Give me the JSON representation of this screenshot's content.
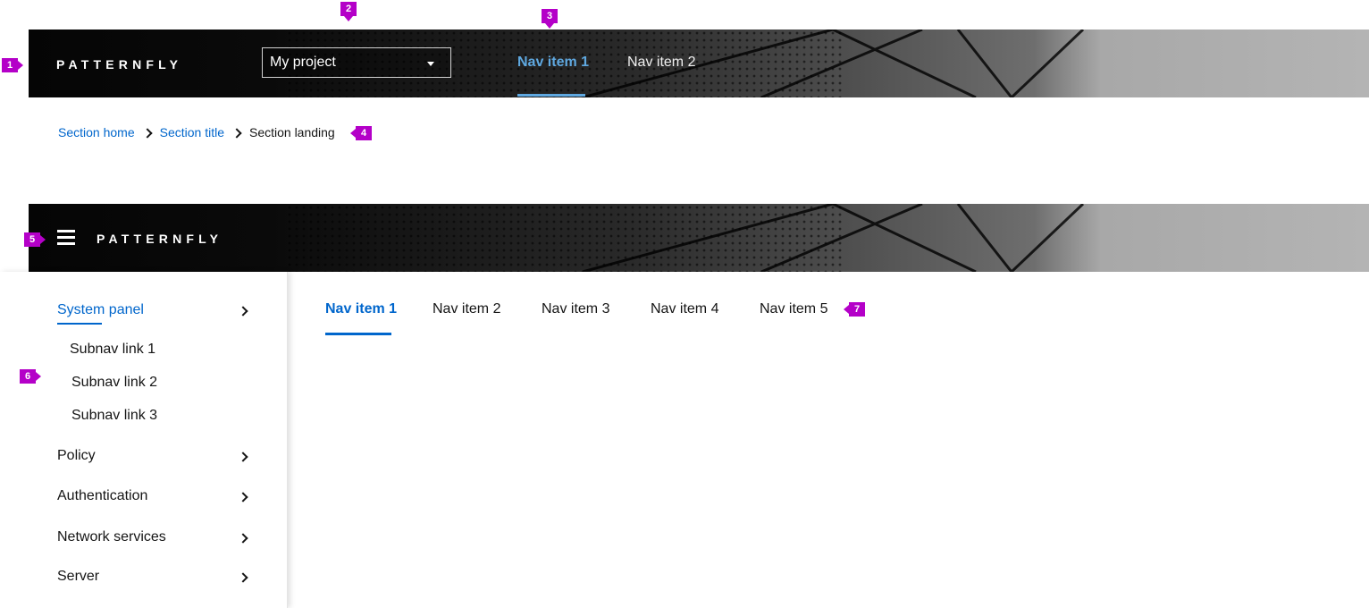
{
  "brand_name": "PATTERNFLY",
  "colors": {
    "accent": "#0066cc",
    "accent_light": "#5fa8e0",
    "marker": "#b400c8"
  },
  "top_masthead": {
    "project_select": {
      "value": "My project",
      "icon": "caret-down-icon"
    },
    "nav_items": [
      {
        "label": "Nav item 1",
        "active": true
      },
      {
        "label": "Nav item 2",
        "active": false
      }
    ]
  },
  "breadcrumb": {
    "items": [
      "Section home",
      "Section title"
    ],
    "current": "Section landing",
    "separator_icon": "chevron-right-icon"
  },
  "second_masthead": {
    "menu_icon": "hamburger-icon"
  },
  "sidebar": {
    "items": [
      {
        "label": "System panel",
        "active": true,
        "expanded": true
      },
      {
        "label": "Policy"
      },
      {
        "label": "Authentication"
      },
      {
        "label": "Network services"
      },
      {
        "label": "Server"
      }
    ],
    "subnav": [
      "Subnav link 1",
      "Subnav link 2",
      "Subnav link 3"
    ]
  },
  "tabs": [
    {
      "label": "Nav item 1",
      "active": true
    },
    {
      "label": "Nav item 2"
    },
    {
      "label": "Nav item 3"
    },
    {
      "label": "Nav item 4"
    },
    {
      "label": "Nav item 5"
    }
  ],
  "markers": [
    "1",
    "2",
    "3",
    "4",
    "5",
    "6",
    "7"
  ]
}
